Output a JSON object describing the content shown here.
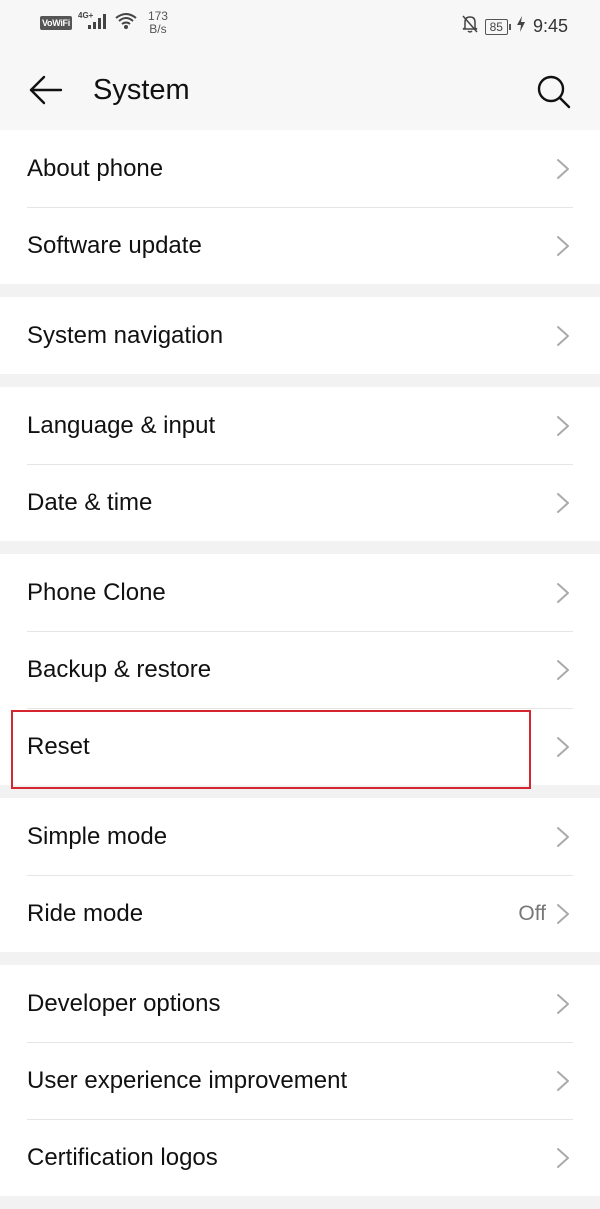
{
  "status_bar": {
    "vowifi": "VoWiFi",
    "network": "4G+",
    "speed_value": "173",
    "speed_unit": "B/s",
    "battery": "85",
    "time": "9:45",
    "icons": [
      "vowifi-icon",
      "signal-icon",
      "wifi-icon",
      "bell-off-icon",
      "battery-icon",
      "charging-icon"
    ]
  },
  "header": {
    "title": "System",
    "back_icon": "arrow-left-icon",
    "search_icon": "search-icon"
  },
  "groups": [
    {
      "items": [
        {
          "label": "About phone"
        },
        {
          "label": "Software update"
        }
      ]
    },
    {
      "items": [
        {
          "label": "System navigation"
        }
      ]
    },
    {
      "items": [
        {
          "label": "Language & input"
        },
        {
          "label": "Date & time"
        }
      ]
    },
    {
      "items": [
        {
          "label": "Phone Clone"
        },
        {
          "label": "Backup & restore"
        },
        {
          "label": "Reset",
          "highlighted": true
        }
      ]
    },
    {
      "items": [
        {
          "label": "Simple mode"
        },
        {
          "label": "Ride mode",
          "value": "Off"
        }
      ]
    },
    {
      "items": [
        {
          "label": "Developer options"
        },
        {
          "label": "User experience improvement"
        },
        {
          "label": "Certification logos"
        }
      ]
    }
  ],
  "colors": {
    "highlight_border": "#d3262e",
    "background": "#f2f2f2",
    "chevron": "#aaaaaa"
  }
}
